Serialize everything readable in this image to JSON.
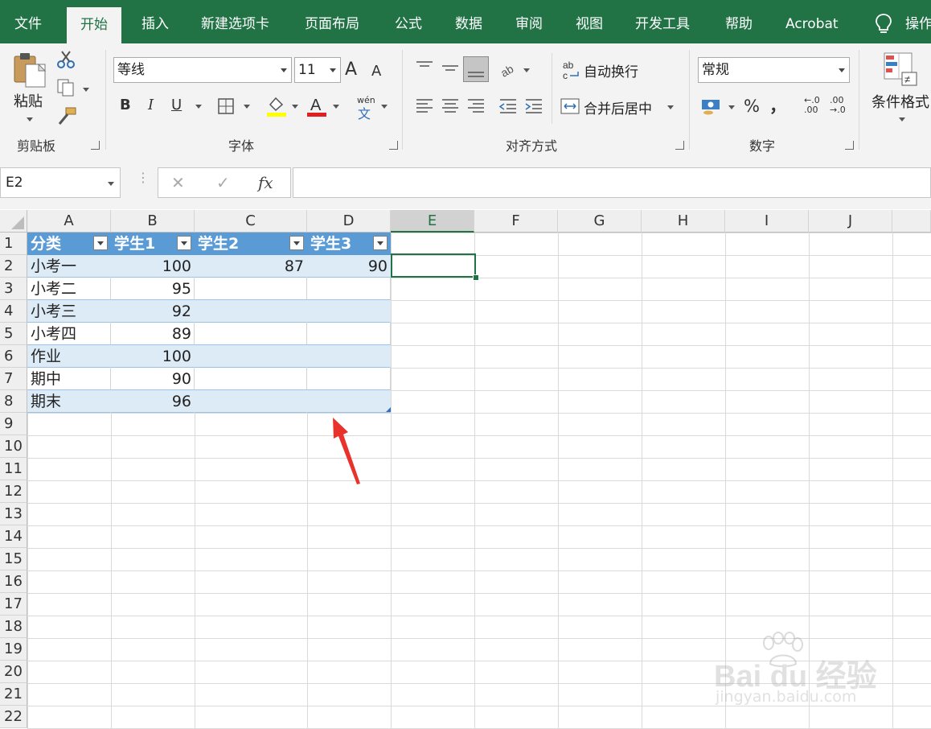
{
  "tabs": [
    "文件",
    "开始",
    "插入",
    "新建选项卡",
    "页面布局",
    "公式",
    "数据",
    "审阅",
    "视图",
    "开发工具",
    "帮助",
    "Acrobat",
    "操作"
  ],
  "ribbon": {
    "clipboard": {
      "paste_label": "粘贴",
      "group_label": "剪贴板"
    },
    "font": {
      "font_name": "等线",
      "font_size": "11",
      "bold": "B",
      "italic": "I",
      "underline": "U",
      "grow": "A",
      "shrink": "A",
      "phonetic_top": "wén",
      "phonetic_bottom": "文",
      "group_label": "字体"
    },
    "alignment": {
      "wrap_label": "自动换行",
      "merge_label": "合并后居中",
      "wrap_icon_text": "ab",
      "group_label": "对齐方式"
    },
    "number": {
      "format": "常规",
      "percent": "%",
      "comma": "，",
      "inc_top": "←.0",
      "inc_bottom": ".00",
      "dec_top": ".00",
      "dec_bottom": "→.0",
      "group_label": "数字"
    },
    "styles": {
      "cond_format_label": "条件格式"
    }
  },
  "formula_bar": {
    "name_box": "E2",
    "cancel": "✕",
    "enter": "✓",
    "fx": "fx",
    "formula": ""
  },
  "columns": [
    "A",
    "B",
    "C",
    "D",
    "E",
    "F",
    "G",
    "H",
    "I",
    "J"
  ],
  "rows": [
    "1",
    "2",
    "3",
    "4",
    "5",
    "6",
    "7",
    "8",
    "9",
    "10",
    "11",
    "12",
    "13",
    "14",
    "15",
    "16",
    "17",
    "18",
    "19",
    "20",
    "21",
    "22"
  ],
  "selected_cell": "E2",
  "table": {
    "headers": [
      "分类",
      "学生1",
      "学生2",
      "学生3"
    ],
    "rows": [
      [
        "小考一",
        "100",
        "87",
        "90"
      ],
      [
        "小考二",
        "95",
        "",
        ""
      ],
      [
        "小考三",
        "92",
        "",
        ""
      ],
      [
        "小考四",
        "89",
        "",
        ""
      ],
      [
        "作业",
        "100",
        "",
        ""
      ],
      [
        "期中",
        "90",
        "",
        ""
      ],
      [
        "期末",
        "96",
        "",
        ""
      ]
    ]
  },
  "watermark": {
    "brand": "Bai du 经验",
    "url": "jingyan.baidu.com"
  },
  "colors": {
    "excel_green": "#217346",
    "table_header": "#5b9bd5",
    "table_band": "#ddebf7",
    "arrow": "#e8322b"
  }
}
